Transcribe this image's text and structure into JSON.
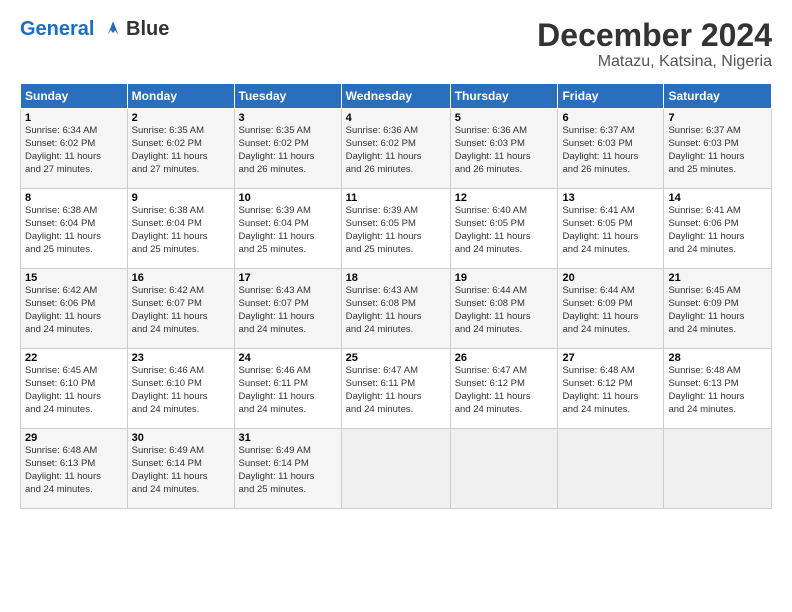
{
  "logo": {
    "line1": "General",
    "line2": "Blue"
  },
  "title": "December 2024",
  "subtitle": "Matazu, Katsina, Nigeria",
  "calendar": {
    "headers": [
      "Sunday",
      "Monday",
      "Tuesday",
      "Wednesday",
      "Thursday",
      "Friday",
      "Saturday"
    ],
    "weeks": [
      [
        {
          "day": "1",
          "info": "Sunrise: 6:34 AM\nSunset: 6:02 PM\nDaylight: 11 hours\nand 27 minutes."
        },
        {
          "day": "2",
          "info": "Sunrise: 6:35 AM\nSunset: 6:02 PM\nDaylight: 11 hours\nand 27 minutes."
        },
        {
          "day": "3",
          "info": "Sunrise: 6:35 AM\nSunset: 6:02 PM\nDaylight: 11 hours\nand 26 minutes."
        },
        {
          "day": "4",
          "info": "Sunrise: 6:36 AM\nSunset: 6:02 PM\nDaylight: 11 hours\nand 26 minutes."
        },
        {
          "day": "5",
          "info": "Sunrise: 6:36 AM\nSunset: 6:03 PM\nDaylight: 11 hours\nand 26 minutes."
        },
        {
          "day": "6",
          "info": "Sunrise: 6:37 AM\nSunset: 6:03 PM\nDaylight: 11 hours\nand 26 minutes."
        },
        {
          "day": "7",
          "info": "Sunrise: 6:37 AM\nSunset: 6:03 PM\nDaylight: 11 hours\nand 25 minutes."
        }
      ],
      [
        {
          "day": "8",
          "info": "Sunrise: 6:38 AM\nSunset: 6:04 PM\nDaylight: 11 hours\nand 25 minutes."
        },
        {
          "day": "9",
          "info": "Sunrise: 6:38 AM\nSunset: 6:04 PM\nDaylight: 11 hours\nand 25 minutes."
        },
        {
          "day": "10",
          "info": "Sunrise: 6:39 AM\nSunset: 6:04 PM\nDaylight: 11 hours\nand 25 minutes."
        },
        {
          "day": "11",
          "info": "Sunrise: 6:39 AM\nSunset: 6:05 PM\nDaylight: 11 hours\nand 25 minutes."
        },
        {
          "day": "12",
          "info": "Sunrise: 6:40 AM\nSunset: 6:05 PM\nDaylight: 11 hours\nand 24 minutes."
        },
        {
          "day": "13",
          "info": "Sunrise: 6:41 AM\nSunset: 6:05 PM\nDaylight: 11 hours\nand 24 minutes."
        },
        {
          "day": "14",
          "info": "Sunrise: 6:41 AM\nSunset: 6:06 PM\nDaylight: 11 hours\nand 24 minutes."
        }
      ],
      [
        {
          "day": "15",
          "info": "Sunrise: 6:42 AM\nSunset: 6:06 PM\nDaylight: 11 hours\nand 24 minutes."
        },
        {
          "day": "16",
          "info": "Sunrise: 6:42 AM\nSunset: 6:07 PM\nDaylight: 11 hours\nand 24 minutes."
        },
        {
          "day": "17",
          "info": "Sunrise: 6:43 AM\nSunset: 6:07 PM\nDaylight: 11 hours\nand 24 minutes."
        },
        {
          "day": "18",
          "info": "Sunrise: 6:43 AM\nSunset: 6:08 PM\nDaylight: 11 hours\nand 24 minutes."
        },
        {
          "day": "19",
          "info": "Sunrise: 6:44 AM\nSunset: 6:08 PM\nDaylight: 11 hours\nand 24 minutes."
        },
        {
          "day": "20",
          "info": "Sunrise: 6:44 AM\nSunset: 6:09 PM\nDaylight: 11 hours\nand 24 minutes."
        },
        {
          "day": "21",
          "info": "Sunrise: 6:45 AM\nSunset: 6:09 PM\nDaylight: 11 hours\nand 24 minutes."
        }
      ],
      [
        {
          "day": "22",
          "info": "Sunrise: 6:45 AM\nSunset: 6:10 PM\nDaylight: 11 hours\nand 24 minutes."
        },
        {
          "day": "23",
          "info": "Sunrise: 6:46 AM\nSunset: 6:10 PM\nDaylight: 11 hours\nand 24 minutes."
        },
        {
          "day": "24",
          "info": "Sunrise: 6:46 AM\nSunset: 6:11 PM\nDaylight: 11 hours\nand 24 minutes."
        },
        {
          "day": "25",
          "info": "Sunrise: 6:47 AM\nSunset: 6:11 PM\nDaylight: 11 hours\nand 24 minutes."
        },
        {
          "day": "26",
          "info": "Sunrise: 6:47 AM\nSunset: 6:12 PM\nDaylight: 11 hours\nand 24 minutes."
        },
        {
          "day": "27",
          "info": "Sunrise: 6:48 AM\nSunset: 6:12 PM\nDaylight: 11 hours\nand 24 minutes."
        },
        {
          "day": "28",
          "info": "Sunrise: 6:48 AM\nSunset: 6:13 PM\nDaylight: 11 hours\nand 24 minutes."
        }
      ],
      [
        {
          "day": "29",
          "info": "Sunrise: 6:48 AM\nSunset: 6:13 PM\nDaylight: 11 hours\nand 24 minutes."
        },
        {
          "day": "30",
          "info": "Sunrise: 6:49 AM\nSunset: 6:14 PM\nDaylight: 11 hours\nand 24 minutes."
        },
        {
          "day": "31",
          "info": "Sunrise: 6:49 AM\nSunset: 6:14 PM\nDaylight: 11 hours\nand 25 minutes."
        },
        {
          "day": "",
          "info": ""
        },
        {
          "day": "",
          "info": ""
        },
        {
          "day": "",
          "info": ""
        },
        {
          "day": "",
          "info": ""
        }
      ]
    ]
  }
}
